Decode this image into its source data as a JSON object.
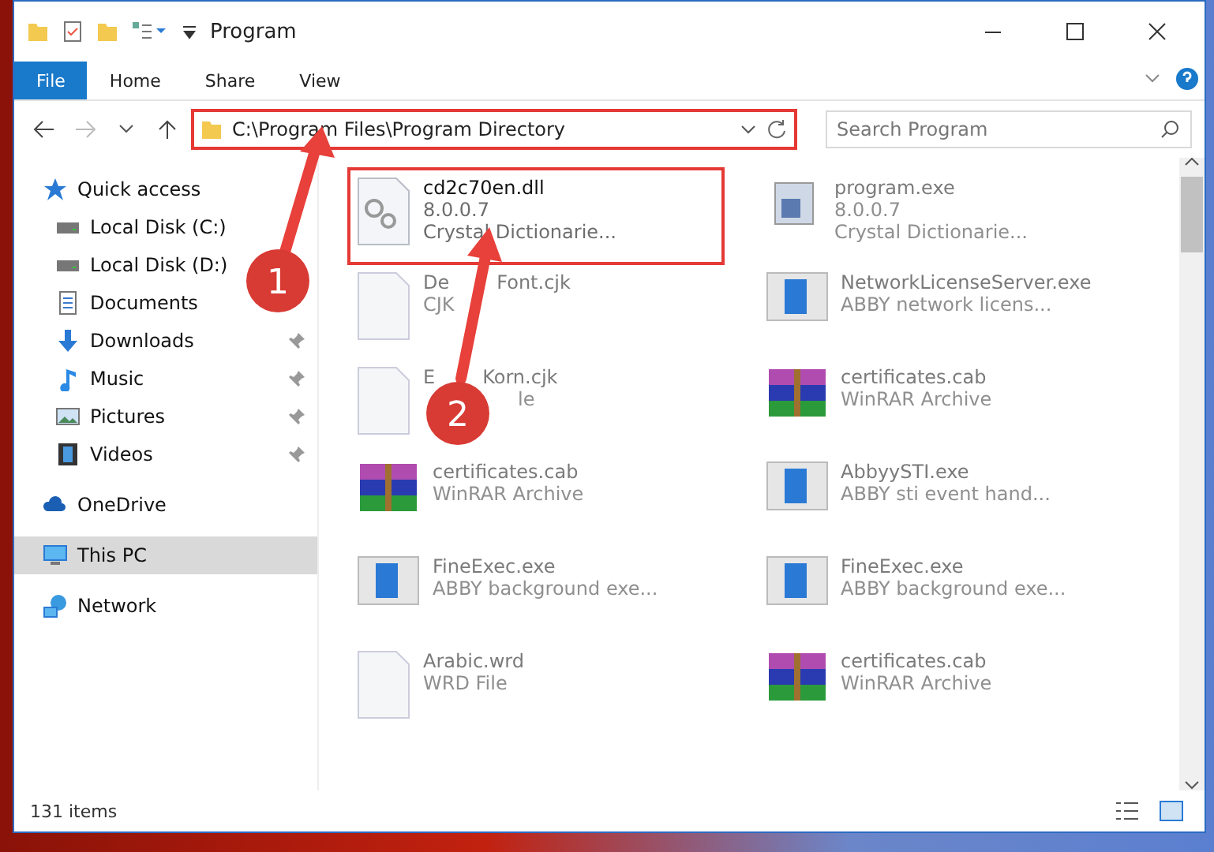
{
  "window": {
    "title": "Program"
  },
  "ribbon": {
    "tabs": [
      {
        "label": "File",
        "selected": true
      },
      {
        "label": "Home",
        "selected": false
      },
      {
        "label": "Share",
        "selected": false
      },
      {
        "label": "View",
        "selected": false
      }
    ]
  },
  "address": {
    "path": "C:\\Program Files\\Program Directory",
    "highlighted": true
  },
  "search": {
    "placeholder": "Search Program"
  },
  "sidebar": {
    "items": [
      {
        "label": "Quick access",
        "kind": "star",
        "selected": false,
        "children": [
          {
            "label": "Local Disk (C:)",
            "kind": "disk",
            "pinned": false,
            "selected": false
          },
          {
            "label": "Local Disk (D:)",
            "kind": "disk",
            "pinned": false,
            "selected": false
          },
          {
            "label": "Documents",
            "kind": "doc",
            "pinned": false,
            "selected": false
          },
          {
            "label": "Downloads",
            "kind": "download",
            "pinned": true,
            "selected": false
          },
          {
            "label": "Music",
            "kind": "music",
            "pinned": true,
            "selected": false
          },
          {
            "label": "Pictures",
            "kind": "picture",
            "pinned": true,
            "selected": false
          },
          {
            "label": "Videos",
            "kind": "video",
            "pinned": true,
            "selected": false
          }
        ]
      },
      {
        "label": "OneDrive",
        "kind": "cloud",
        "selected": false
      },
      {
        "label": "This PC",
        "kind": "pc",
        "selected": true
      },
      {
        "label": "Network",
        "kind": "network",
        "selected": false
      }
    ]
  },
  "files": [
    {
      "name": [
        "cd2c70en.dll"
      ],
      "lines": [
        [
          "8.0.0.7"
        ],
        [
          "Crystal Dictionarie..."
        ]
      ],
      "kind": "dll",
      "highlighted": true
    },
    {
      "name": [
        "program.exe"
      ],
      "lines": [
        [
          "8.0.0.7"
        ],
        [
          "Crystal Dictionarie..."
        ]
      ],
      "kind": "setup",
      "highlighted": false
    },
    {
      "name": [
        "De",
        {
          "kind": "covered"
        },
        "Font.cjk"
      ],
      "lines": [
        [
          "CJK"
        ]
      ],
      "kind": "blank",
      "highlighted": false
    },
    {
      "name": [
        "NetworkLicenseServer.exe"
      ],
      "lines": [
        [
          "ABBY network licens..."
        ]
      ],
      "kind": "app",
      "highlighted": false
    },
    {
      "name": [
        "E",
        {
          "kind": "covered"
        },
        "Korn.cjk"
      ],
      "lines": [
        [
          {
            "kind": "covered"
          },
          {
            "kind": "covered"
          },
          "le"
        ]
      ],
      "kind": "blank",
      "highlighted": false
    },
    {
      "name": [
        "certificates.cab"
      ],
      "lines": [
        [
          "WinRAR Archive"
        ]
      ],
      "kind": "archive",
      "highlighted": false
    },
    {
      "name": [
        "certificates.cab"
      ],
      "lines": [
        [
          "WinRAR Archive"
        ]
      ],
      "kind": "archive",
      "highlighted": false
    },
    {
      "name": [
        "AbbyySTI.exe"
      ],
      "lines": [
        [
          "ABBY sti event hand..."
        ]
      ],
      "kind": "app",
      "highlighted": false
    },
    {
      "name": [
        "FineExec.exe"
      ],
      "lines": [
        [
          "ABBY background exe..."
        ]
      ],
      "kind": "app",
      "highlighted": false
    },
    {
      "name": [
        "FineExec.exe"
      ],
      "lines": [
        [
          "ABBY background exe..."
        ]
      ],
      "kind": "app",
      "highlighted": false
    },
    {
      "name": [
        "Arabic.wrd"
      ],
      "lines": [
        [
          "WRD File"
        ]
      ],
      "kind": "blank",
      "highlighted": false
    },
    {
      "name": [
        "certificates.cab"
      ],
      "lines": [
        [
          "WinRAR Archive"
        ]
      ],
      "kind": "archive",
      "highlighted": false
    }
  ],
  "status_bar": {
    "count": "131 items"
  },
  "callouts": [
    "1",
    "2"
  ]
}
